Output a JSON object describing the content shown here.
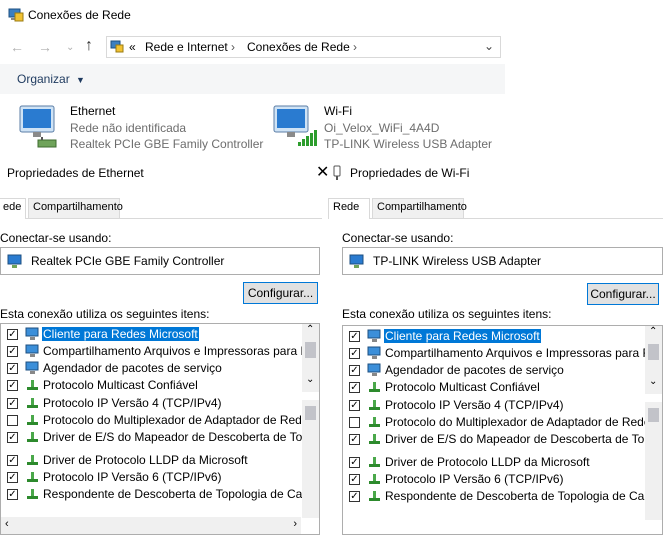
{
  "window": {
    "title": "Conexões de Rede"
  },
  "address": {
    "prefix": "«",
    "crumb1": "Rede e Internet",
    "sep": "›",
    "crumb2": "Conexões de Rede"
  },
  "toolbar": {
    "organize": "Organizar"
  },
  "connections": [
    {
      "name": "Ethernet",
      "status": "Rede não identificada",
      "adapter": "Realtek PCIe GBE Family Controller"
    },
    {
      "name": "Wi-Fi",
      "status": "Oi_Velox_WiFi_4A4D",
      "adapter": "TP-LINK Wireless USB Adapter"
    }
  ],
  "dialogs": [
    {
      "title": "Propriedades de Ethernet",
      "tabs": [
        "ede",
        "Compartilhamento"
      ],
      "connect_label": "Conectar-se usando:",
      "adapter": "Realtek PCIe GBE Family Controller",
      "configure": "Configurar...",
      "items_label": "Esta conexão utiliza os seguintes itens:",
      "items": [
        {
          "label": "Cliente para Redes Microsoft",
          "checked": true
        },
        {
          "label": "Compartilhamento Arquivos e Impressoras para Redes",
          "checked": true
        },
        {
          "label": "Agendador de pacotes de serviço",
          "checked": true
        },
        {
          "label": "Protocolo Multicast Confiável",
          "checked": true
        },
        {
          "label": "Protocolo IP Versão 4 (TCP/IPv4)",
          "checked": true
        },
        {
          "label": "Protocolo do Multiplexador de Adaptador de Rede da M",
          "checked": false
        },
        {
          "label": "Driver de E/S do Mapeador de Descoberta de Topolog",
          "checked": true
        },
        {
          "label": "Driver de Protocolo LLDP da Microsoft",
          "checked": true
        },
        {
          "label": "Protocolo IP Versão 6 (TCP/IPv6)",
          "checked": true
        },
        {
          "label": "Respondente de Descoberta de Topologia de Camada",
          "checked": true
        }
      ]
    },
    {
      "title": "Propriedades de Wi-Fi",
      "tabs": [
        "Rede",
        "Compartilhamento"
      ],
      "connect_label": "Conectar-se usando:",
      "adapter": "TP-LINK Wireless USB Adapter",
      "configure": "Configurar...",
      "items_label": "Esta conexão utiliza os seguintes itens:",
      "items": [
        {
          "label": "Cliente para Redes Microsoft",
          "checked": true
        },
        {
          "label": "Compartilhamento Arquivos e Impressoras para Redes",
          "checked": true
        },
        {
          "label": "Agendador de pacotes de serviço",
          "checked": true
        },
        {
          "label": "Protocolo Multicast Confiável",
          "checked": true
        },
        {
          "label": "Protocolo IP Versão 4 (TCP/IPv4)",
          "checked": true
        },
        {
          "label": "Protocolo do Multiplexador de Adaptador de Rede da M",
          "checked": false
        },
        {
          "label": "Driver de E/S do Mapeador de Descoberta de Topolog",
          "checked": true
        },
        {
          "label": "Driver de Protocolo LLDP da Microsoft",
          "checked": true
        },
        {
          "label": "Protocolo IP Versão 6 (TCP/IPv6)",
          "checked": true
        },
        {
          "label": "Respondente de Descoberta de Topologia de Camada",
          "checked": true
        }
      ]
    }
  ],
  "colors": {
    "selection": "#0078d7",
    "accent": "#0078d7"
  }
}
